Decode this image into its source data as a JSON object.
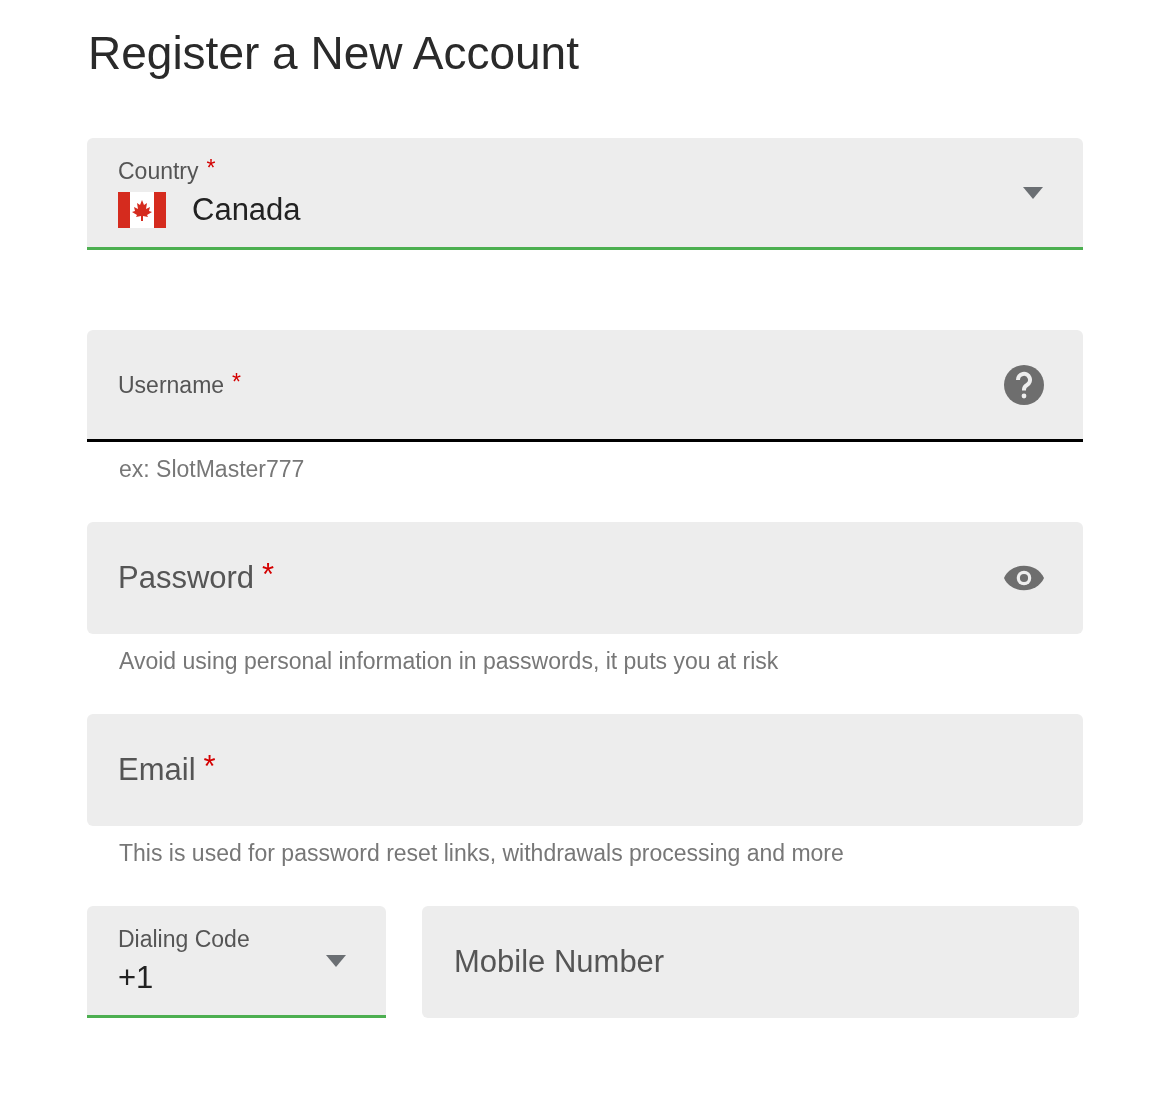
{
  "title": "Register a New Account",
  "fields": [
    {
      "kind": "country",
      "label": "Country",
      "mark": "*",
      "value": "Canada",
      "valid": true
    },
    {
      "kind": "text",
      "label": "Username",
      "mark": "*",
      "help": true,
      "focused": true,
      "hint": "ex: SlotMaster777"
    },
    {
      "kind": "password",
      "label": "Password",
      "mark": "*",
      "hint": "Avoid using personal information in passwords, it puts you at risk"
    },
    {
      "kind": "text",
      "label": "Email",
      "mark": "*",
      "hint": "This is used for password reset links, withdrawals processing and more"
    }
  ],
  "phone": [
    {
      "kind": "select",
      "label": "Dialing Code",
      "value": "+1",
      "valid": true
    },
    {
      "kind": "text",
      "label": "Mobile Number"
    }
  ]
}
